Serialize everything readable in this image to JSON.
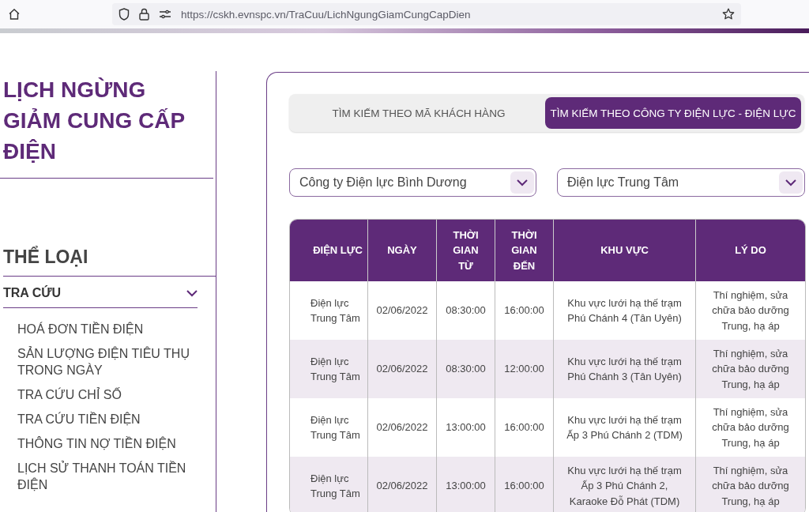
{
  "browser": {
    "url": "https://cskh.evnspc.vn/TraCuu/LichNgungGiamCungCapDien"
  },
  "sidebar": {
    "title": "LỊCH NGỪNG GIẢM CUNG CẤP ĐIỆN",
    "category_heading": "THỂ LOẠI",
    "group": {
      "label": "TRA CỨU",
      "expanded": true
    },
    "items": [
      "HOÁ ĐƠN TIỀN ĐIỆN",
      "SẢN LƯỢNG ĐIỆN TIÊU THỤ TRONG NGÀY",
      "TRA CỨU CHỈ SỐ",
      "TRA CỨU TIỀN ĐIỆN",
      "THÔNG TIN NỢ TIỀN ĐIỆN",
      "LỊCH SỬ THANH TOÁN TIỀN ĐIỆN"
    ]
  },
  "tabs": [
    {
      "label": "TÌM KIẾM THEO MÃ KHÁCH HÀNG",
      "selected": false
    },
    {
      "label": "TÌM KIẾM THEO CÔNG TY ĐIỆN LỰC - ĐIỆN LỰC",
      "selected": true
    }
  ],
  "selects": [
    {
      "value": "Công ty Điện lực Bình Dương"
    },
    {
      "value": "Điện lực Trung Tâm"
    }
  ],
  "table": {
    "columns": [
      "ĐIỆN LỰC",
      "NGÀY",
      "THỜI GIAN TỪ",
      "THỜI GIAN ĐẾN",
      "KHU VỰC",
      "LÝ DO"
    ],
    "rows": [
      [
        "Điện lực Trung Tâm",
        "02/06/2022",
        "08:30:00",
        "16:00:00",
        "Khu vực lưới hạ thế trạm Phú Chánh 4 (Tân Uyên)",
        "Thí nghiệm, sửa chữa bảo dưỡng Trung, hạ áp"
      ],
      [
        "Điện lực Trung Tâm",
        "02/06/2022",
        "08:30:00",
        "12:00:00",
        "Khu vực lưới hạ thế trạm Phú Chánh 3 (Tân Uyên)",
        "Thí nghiệm, sửa chữa bảo dưỡng Trung, hạ áp"
      ],
      [
        "Điện lực Trung Tâm",
        "02/06/2022",
        "13:00:00",
        "16:00:00",
        "Khu vực lưới hạ thế trạm Ấp 3 Phú Chánh 2 (TDM)",
        "Thí nghiệm, sửa chữa bảo dưỡng Trung, hạ áp"
      ],
      [
        "Điện lực Trung Tâm",
        "02/06/2022",
        "13:00:00",
        "16:00:00",
        "Khu vực lưới hạ thế trạm Ấp 3 Phú Chánh 2, Karaoke Đỗ Phát (TDM)",
        "Thí nghiệm, sửa chữa bảo dưỡng Trung, hạ áp"
      ]
    ]
  }
}
